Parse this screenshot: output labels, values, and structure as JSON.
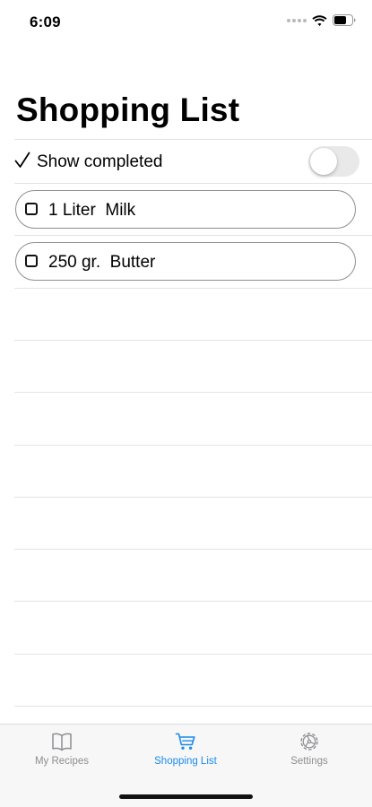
{
  "status_bar": {
    "time": "6:09",
    "icons": [
      "cellular-dots-icon",
      "wifi-icon",
      "battery-icon"
    ]
  },
  "page": {
    "title": "Shopping List"
  },
  "filter": {
    "check_glyph": "✓",
    "label": "Show completed",
    "toggle_on": false
  },
  "items": [
    {
      "label": "1 Liter  Milk",
      "completed": false
    },
    {
      "label": "250 gr.  Butter",
      "completed": false
    }
  ],
  "tab_bar": {
    "tabs": [
      {
        "label": "My Recipes",
        "icon": "book-icon",
        "active": false
      },
      {
        "label": "Shopping List",
        "icon": "cart-icon",
        "active": true
      },
      {
        "label": "Settings",
        "icon": "gear-icon",
        "active": false
      }
    ]
  },
  "colors": {
    "accent": "#1d8bea",
    "inactive": "#8e8e93",
    "separator": "#e3e3e6"
  }
}
